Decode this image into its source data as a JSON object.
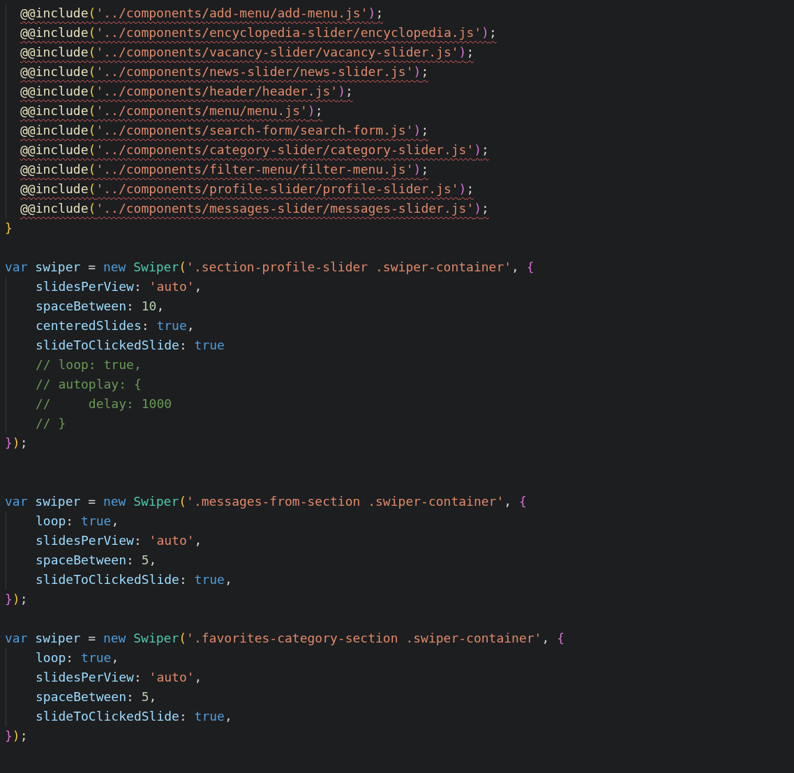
{
  "editor": {
    "blocks": [
      {
        "kind": "fragment",
        "body": [
          {
            "error": true,
            "tokens": [
              {
                "kind": "directive",
                "text": "@@include"
              },
              {
                "kind": "paren1",
                "text": "("
              },
              {
                "kind": "string",
                "text": "'../components/add-menu/add-menu.js'"
              },
              {
                "kind": "paren2",
                "text": ")"
              },
              {
                "kind": "punct",
                "text": ";"
              }
            ]
          },
          {
            "error": true,
            "tokens": [
              {
                "kind": "directive",
                "text": "@@include"
              },
              {
                "kind": "paren1",
                "text": "("
              },
              {
                "kind": "string",
                "text": "'../components/encyclopedia-slider/encyclopedia.js'"
              },
              {
                "kind": "paren2",
                "text": ")"
              },
              {
                "kind": "punct",
                "text": ";"
              }
            ]
          },
          {
            "error": true,
            "tokens": [
              {
                "kind": "directive",
                "text": "@@include"
              },
              {
                "kind": "paren1",
                "text": "("
              },
              {
                "kind": "string",
                "text": "'../components/vacancy-slider/vacancy-slider.js'"
              },
              {
                "kind": "paren2",
                "text": ")"
              },
              {
                "kind": "punct",
                "text": ";"
              }
            ]
          },
          {
            "error": true,
            "tokens": [
              {
                "kind": "directive",
                "text": "@@include"
              },
              {
                "kind": "paren1",
                "text": "("
              },
              {
                "kind": "string",
                "text": "'../components/news-slider/news-slider.js'"
              },
              {
                "kind": "paren2",
                "text": ")"
              },
              {
                "kind": "punct",
                "text": ";"
              }
            ]
          },
          {
            "error": true,
            "tokens": [
              {
                "kind": "directive",
                "text": "@@include"
              },
              {
                "kind": "paren1",
                "text": "("
              },
              {
                "kind": "string",
                "text": "'../components/header/header.js'"
              },
              {
                "kind": "paren2",
                "text": ")"
              },
              {
                "kind": "punct",
                "text": ";"
              }
            ]
          },
          {
            "error": true,
            "tokens": [
              {
                "kind": "directive",
                "text": "@@include"
              },
              {
                "kind": "paren1",
                "text": "("
              },
              {
                "kind": "string",
                "text": "'../components/menu/menu.js'"
              },
              {
                "kind": "paren2",
                "text": ")"
              },
              {
                "kind": "punct",
                "text": ";"
              }
            ]
          },
          {
            "error": true,
            "tokens": [
              {
                "kind": "directive",
                "text": "@@include"
              },
              {
                "kind": "paren1",
                "text": "("
              },
              {
                "kind": "string",
                "text": "'../components/search-form/search-form.js'"
              },
              {
                "kind": "paren2",
                "text": ")"
              },
              {
                "kind": "punct",
                "text": ";"
              }
            ]
          },
          {
            "error": true,
            "tokens": [
              {
                "kind": "directive",
                "text": "@@include"
              },
              {
                "kind": "paren1",
                "text": "("
              },
              {
                "kind": "string",
                "text": "'../components/category-slider/category-slider.js'"
              },
              {
                "kind": "paren2",
                "text": ")"
              },
              {
                "kind": "punct",
                "text": ";"
              }
            ]
          },
          {
            "error": true,
            "tokens": [
              {
                "kind": "directive",
                "text": "@@include"
              },
              {
                "kind": "paren1",
                "text": "("
              },
              {
                "kind": "string",
                "text": "'../components/filter-menu/filter-menu.js'"
              },
              {
                "kind": "paren2",
                "text": ")"
              },
              {
                "kind": "punct",
                "text": ";"
              }
            ]
          },
          {
            "error": true,
            "tokens": [
              {
                "kind": "directive",
                "text": "@@include"
              },
              {
                "kind": "paren1",
                "text": "("
              },
              {
                "kind": "string",
                "text": "'../components/profile-slider/profile-slider.js'"
              },
              {
                "kind": "paren2",
                "text": ")"
              },
              {
                "kind": "punct",
                "text": ";"
              }
            ]
          },
          {
            "error": true,
            "tokens": [
              {
                "kind": "directive",
                "text": "@@include"
              },
              {
                "kind": "paren1",
                "text": "("
              },
              {
                "kind": "string",
                "text": "'../components/messages-slider/messages-slider.js'"
              },
              {
                "kind": "paren2",
                "text": ")"
              },
              {
                "kind": "punct",
                "text": ";"
              }
            ]
          }
        ],
        "footer": [
          {
            "kind": "paren1",
            "text": "}"
          }
        ]
      },
      {
        "kind": "statement",
        "header": [
          {
            "kind": "keyword",
            "text": "var"
          },
          {
            "kind": "variable",
            "text": " swiper"
          },
          {
            "kind": "punct",
            "text": " = "
          },
          {
            "kind": "keyword",
            "text": "new"
          },
          {
            "kind": "class",
            "text": " Swiper"
          },
          {
            "kind": "paren1",
            "text": "("
          },
          {
            "kind": "string",
            "text": "'.section-profile-slider .swiper-container'"
          },
          {
            "kind": "punct",
            "text": ", "
          },
          {
            "kind": "paren2",
            "text": "{"
          }
        ],
        "body": [
          {
            "error": false,
            "tokens": [
              {
                "kind": "property",
                "text": "slidesPerView"
              },
              {
                "kind": "punct",
                "text": ": "
              },
              {
                "kind": "string",
                "text": "'auto'"
              },
              {
                "kind": "punct",
                "text": ","
              }
            ]
          },
          {
            "error": false,
            "tokens": [
              {
                "kind": "property",
                "text": "spaceBetween"
              },
              {
                "kind": "punct",
                "text": ": "
              },
              {
                "kind": "number",
                "text": "10"
              },
              {
                "kind": "punct",
                "text": ","
              }
            ]
          },
          {
            "error": false,
            "tokens": [
              {
                "kind": "property",
                "text": "centeredSlides"
              },
              {
                "kind": "punct",
                "text": ": "
              },
              {
                "kind": "literal",
                "text": "true"
              },
              {
                "kind": "punct",
                "text": ","
              }
            ]
          },
          {
            "error": false,
            "tokens": [
              {
                "kind": "property",
                "text": "slideToClickedSlide"
              },
              {
                "kind": "punct",
                "text": ": "
              },
              {
                "kind": "literal",
                "text": "true"
              }
            ]
          },
          {
            "error": false,
            "tokens": [
              {
                "kind": "comment",
                "text": "// loop: true,"
              }
            ]
          },
          {
            "error": false,
            "tokens": [
              {
                "kind": "comment",
                "text": "// autoplay: {"
              }
            ]
          },
          {
            "error": false,
            "tokens": [
              {
                "kind": "comment",
                "text": "//     delay: 1000"
              }
            ]
          },
          {
            "error": false,
            "tokens": [
              {
                "kind": "comment",
                "text": "// }"
              }
            ]
          }
        ],
        "footer": [
          {
            "kind": "paren2",
            "text": "}"
          },
          {
            "kind": "paren1",
            "text": ")"
          },
          {
            "kind": "punct",
            "text": ";"
          }
        ]
      },
      {
        "kind": "statement",
        "header": [
          {
            "kind": "keyword",
            "text": "var"
          },
          {
            "kind": "variable",
            "text": " swiper"
          },
          {
            "kind": "punct",
            "text": " = "
          },
          {
            "kind": "keyword",
            "text": "new"
          },
          {
            "kind": "class",
            "text": " Swiper"
          },
          {
            "kind": "paren1",
            "text": "("
          },
          {
            "kind": "string",
            "text": "'.messages-from-section .swiper-container'"
          },
          {
            "kind": "punct",
            "text": ", "
          },
          {
            "kind": "paren2",
            "text": "{"
          }
        ],
        "body": [
          {
            "error": false,
            "tokens": [
              {
                "kind": "property",
                "text": "loop"
              },
              {
                "kind": "punct",
                "text": ": "
              },
              {
                "kind": "literal",
                "text": "true"
              },
              {
                "kind": "punct",
                "text": ","
              }
            ]
          },
          {
            "error": false,
            "tokens": [
              {
                "kind": "property",
                "text": "slidesPerView"
              },
              {
                "kind": "punct",
                "text": ": "
              },
              {
                "kind": "string",
                "text": "'auto'"
              },
              {
                "kind": "punct",
                "text": ","
              }
            ]
          },
          {
            "error": false,
            "tokens": [
              {
                "kind": "property",
                "text": "spaceBetween"
              },
              {
                "kind": "punct",
                "text": ": "
              },
              {
                "kind": "number",
                "text": "5"
              },
              {
                "kind": "punct",
                "text": ","
              }
            ]
          },
          {
            "error": false,
            "tokens": [
              {
                "kind": "property",
                "text": "slideToClickedSlide"
              },
              {
                "kind": "punct",
                "text": ": "
              },
              {
                "kind": "literal",
                "text": "true"
              },
              {
                "kind": "punct",
                "text": ","
              }
            ]
          }
        ],
        "footer": [
          {
            "kind": "paren2",
            "text": "}"
          },
          {
            "kind": "paren1",
            "text": ")"
          },
          {
            "kind": "punct",
            "text": ";"
          }
        ]
      },
      {
        "kind": "statement",
        "header": [
          {
            "kind": "keyword",
            "text": "var"
          },
          {
            "kind": "variable",
            "text": " swiper"
          },
          {
            "kind": "punct",
            "text": " = "
          },
          {
            "kind": "keyword",
            "text": "new"
          },
          {
            "kind": "class",
            "text": " Swiper"
          },
          {
            "kind": "paren1",
            "text": "("
          },
          {
            "kind": "string",
            "text": "'.favorites-category-section .swiper-container'"
          },
          {
            "kind": "punct",
            "text": ", "
          },
          {
            "kind": "paren2",
            "text": "{"
          }
        ],
        "body": [
          {
            "error": false,
            "tokens": [
              {
                "kind": "property",
                "text": "loop"
              },
              {
                "kind": "punct",
                "text": ": "
              },
              {
                "kind": "literal",
                "text": "true"
              },
              {
                "kind": "punct",
                "text": ","
              }
            ]
          },
          {
            "error": false,
            "tokens": [
              {
                "kind": "property",
                "text": "slidesPerView"
              },
              {
                "kind": "punct",
                "text": ": "
              },
              {
                "kind": "string",
                "text": "'auto'"
              },
              {
                "kind": "punct",
                "text": ","
              }
            ]
          },
          {
            "error": false,
            "tokens": [
              {
                "kind": "property",
                "text": "spaceBetween"
              },
              {
                "kind": "punct",
                "text": ": "
              },
              {
                "kind": "number",
                "text": "5"
              },
              {
                "kind": "punct",
                "text": ","
              }
            ]
          },
          {
            "error": false,
            "tokens": [
              {
                "kind": "property",
                "text": "slideToClickedSlide"
              },
              {
                "kind": "punct",
                "text": ": "
              },
              {
                "kind": "literal",
                "text": "true"
              },
              {
                "kind": "punct",
                "text": ","
              }
            ]
          }
        ],
        "footer": [
          {
            "kind": "paren2",
            "text": "}"
          },
          {
            "kind": "paren1",
            "text": ")"
          },
          {
            "kind": "punct",
            "text": ";"
          }
        ]
      }
    ]
  }
}
